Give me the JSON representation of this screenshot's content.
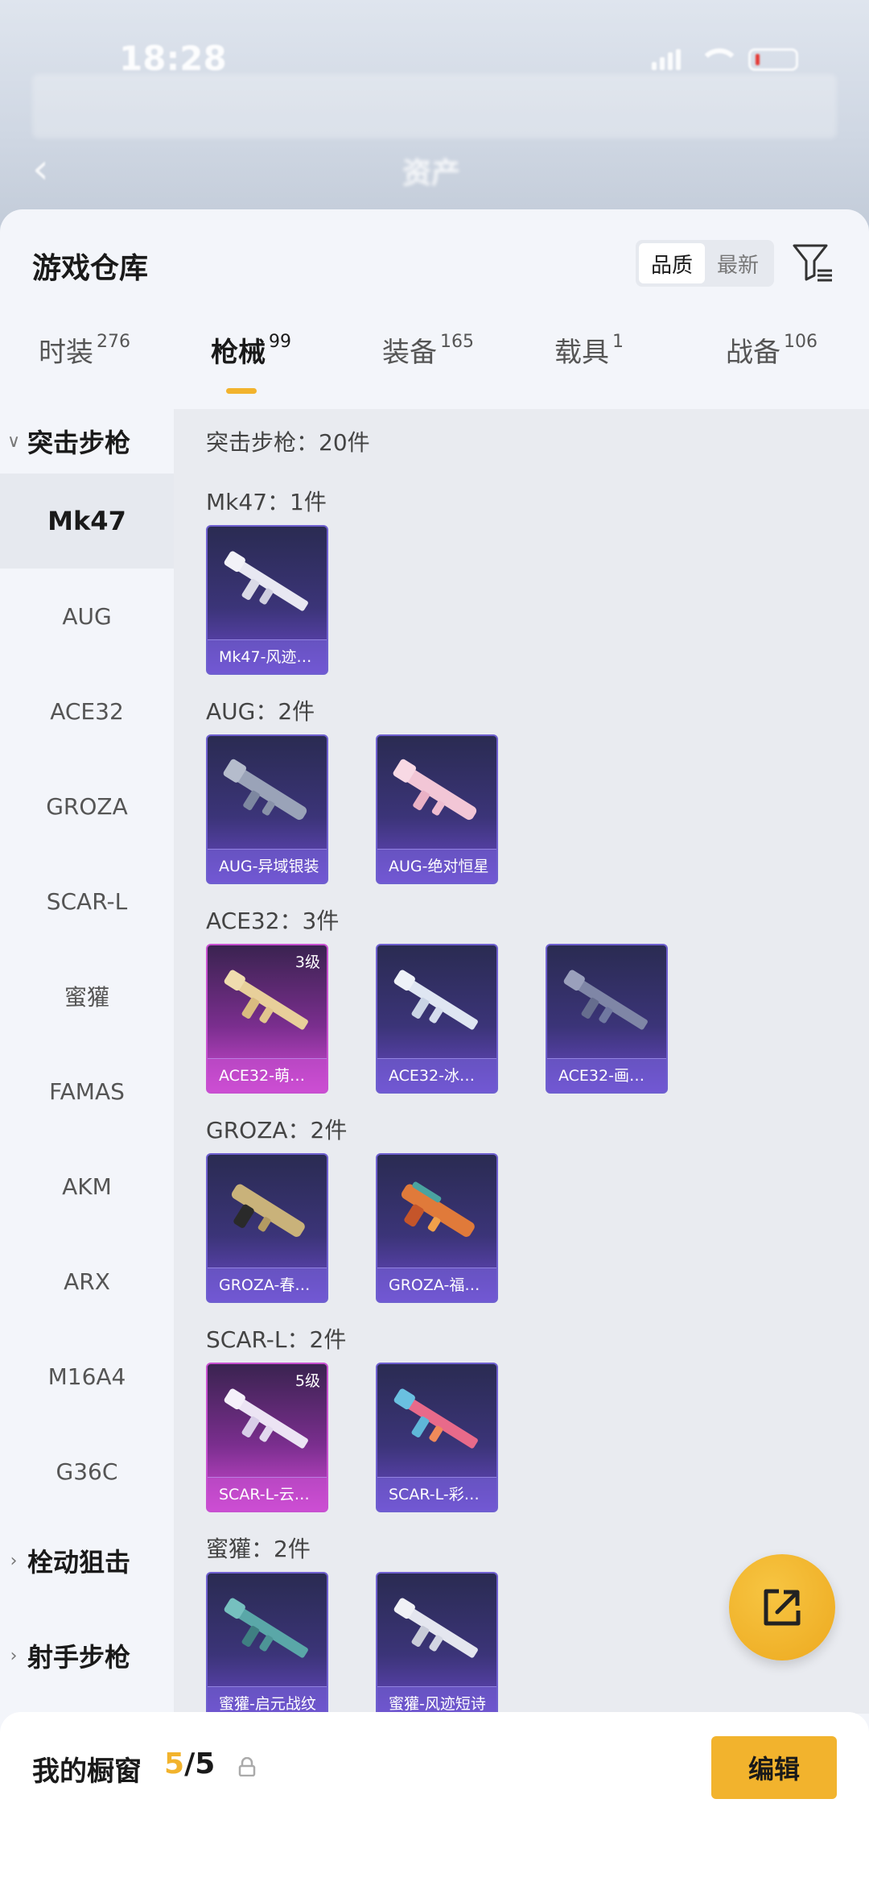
{
  "status_bar": {
    "time": "18:28"
  },
  "background": {
    "back_glyph": "‹",
    "title": "资产"
  },
  "panel": {
    "title": "游戏仓库"
  },
  "sort": {
    "options": [
      "品质",
      "最新"
    ],
    "selected": "品质"
  },
  "tabs": [
    {
      "label": "时装",
      "count": "276"
    },
    {
      "label": "枪械",
      "count": "99",
      "active": true
    },
    {
      "label": "装备",
      "count": "165"
    },
    {
      "label": "载具",
      "count": "1"
    },
    {
      "label": "战备",
      "count": "106"
    }
  ],
  "sidebar": {
    "groups": [
      {
        "label": "突击步枪",
        "expanded": true
      },
      {
        "label": "栓动狙击",
        "expanded": false
      },
      {
        "label": "射手步枪",
        "expanded": false
      }
    ],
    "items": [
      "Mk47",
      "AUG",
      "ACE32",
      "GROZA",
      "SCAR-L",
      "蜜獾",
      "FAMAS",
      "AKM",
      "ARX",
      "M16A4",
      "G36C"
    ],
    "active_item": "Mk47"
  },
  "content": {
    "total": "突击步枪：20件",
    "sections": [
      {
        "label": "Mk47：1件",
        "cards": [
          {
            "name": "Mk47-风迹…",
            "tier": "blue"
          }
        ]
      },
      {
        "label": "AUG：2件",
        "cards": [
          {
            "name": "AUG-异域银装",
            "tier": "blue"
          },
          {
            "name": "AUG-绝对恒星",
            "tier": "blue"
          }
        ]
      },
      {
        "label": "ACE32：3件",
        "cards": [
          {
            "name": "ACE32-萌…",
            "tier": "purple",
            "level": "3级"
          },
          {
            "name": "ACE32-冰…",
            "tier": "blue"
          },
          {
            "name": "ACE32-画…",
            "tier": "blue"
          }
        ]
      },
      {
        "label": "GROZA：2件",
        "cards": [
          {
            "name": "GROZA-春…",
            "tier": "blue"
          },
          {
            "name": "GROZA-福…",
            "tier": "blue"
          }
        ]
      },
      {
        "label": "SCAR-L：2件",
        "cards": [
          {
            "name": "SCAR-L-云…",
            "tier": "purple",
            "level": "5级"
          },
          {
            "name": "SCAR-L-彩…",
            "tier": "blue"
          }
        ]
      },
      {
        "label": "蜜獾：2件",
        "cards": [
          {
            "name": "蜜獾-启元战纹",
            "tier": "blue"
          },
          {
            "name": "蜜獾-风迹短诗",
            "tier": "blue"
          }
        ]
      }
    ]
  },
  "fab": {
    "icon": "share-icon"
  },
  "bottom": {
    "label": "我的橱窗",
    "current": "5",
    "separator": "/",
    "max": "5",
    "lock_icon": "lock-icon",
    "edit_label": "编辑"
  },
  "colors": {
    "accent": "#f2b32d",
    "blue_tier": "#6a49c8",
    "purple_tier": "#d24bd6"
  }
}
